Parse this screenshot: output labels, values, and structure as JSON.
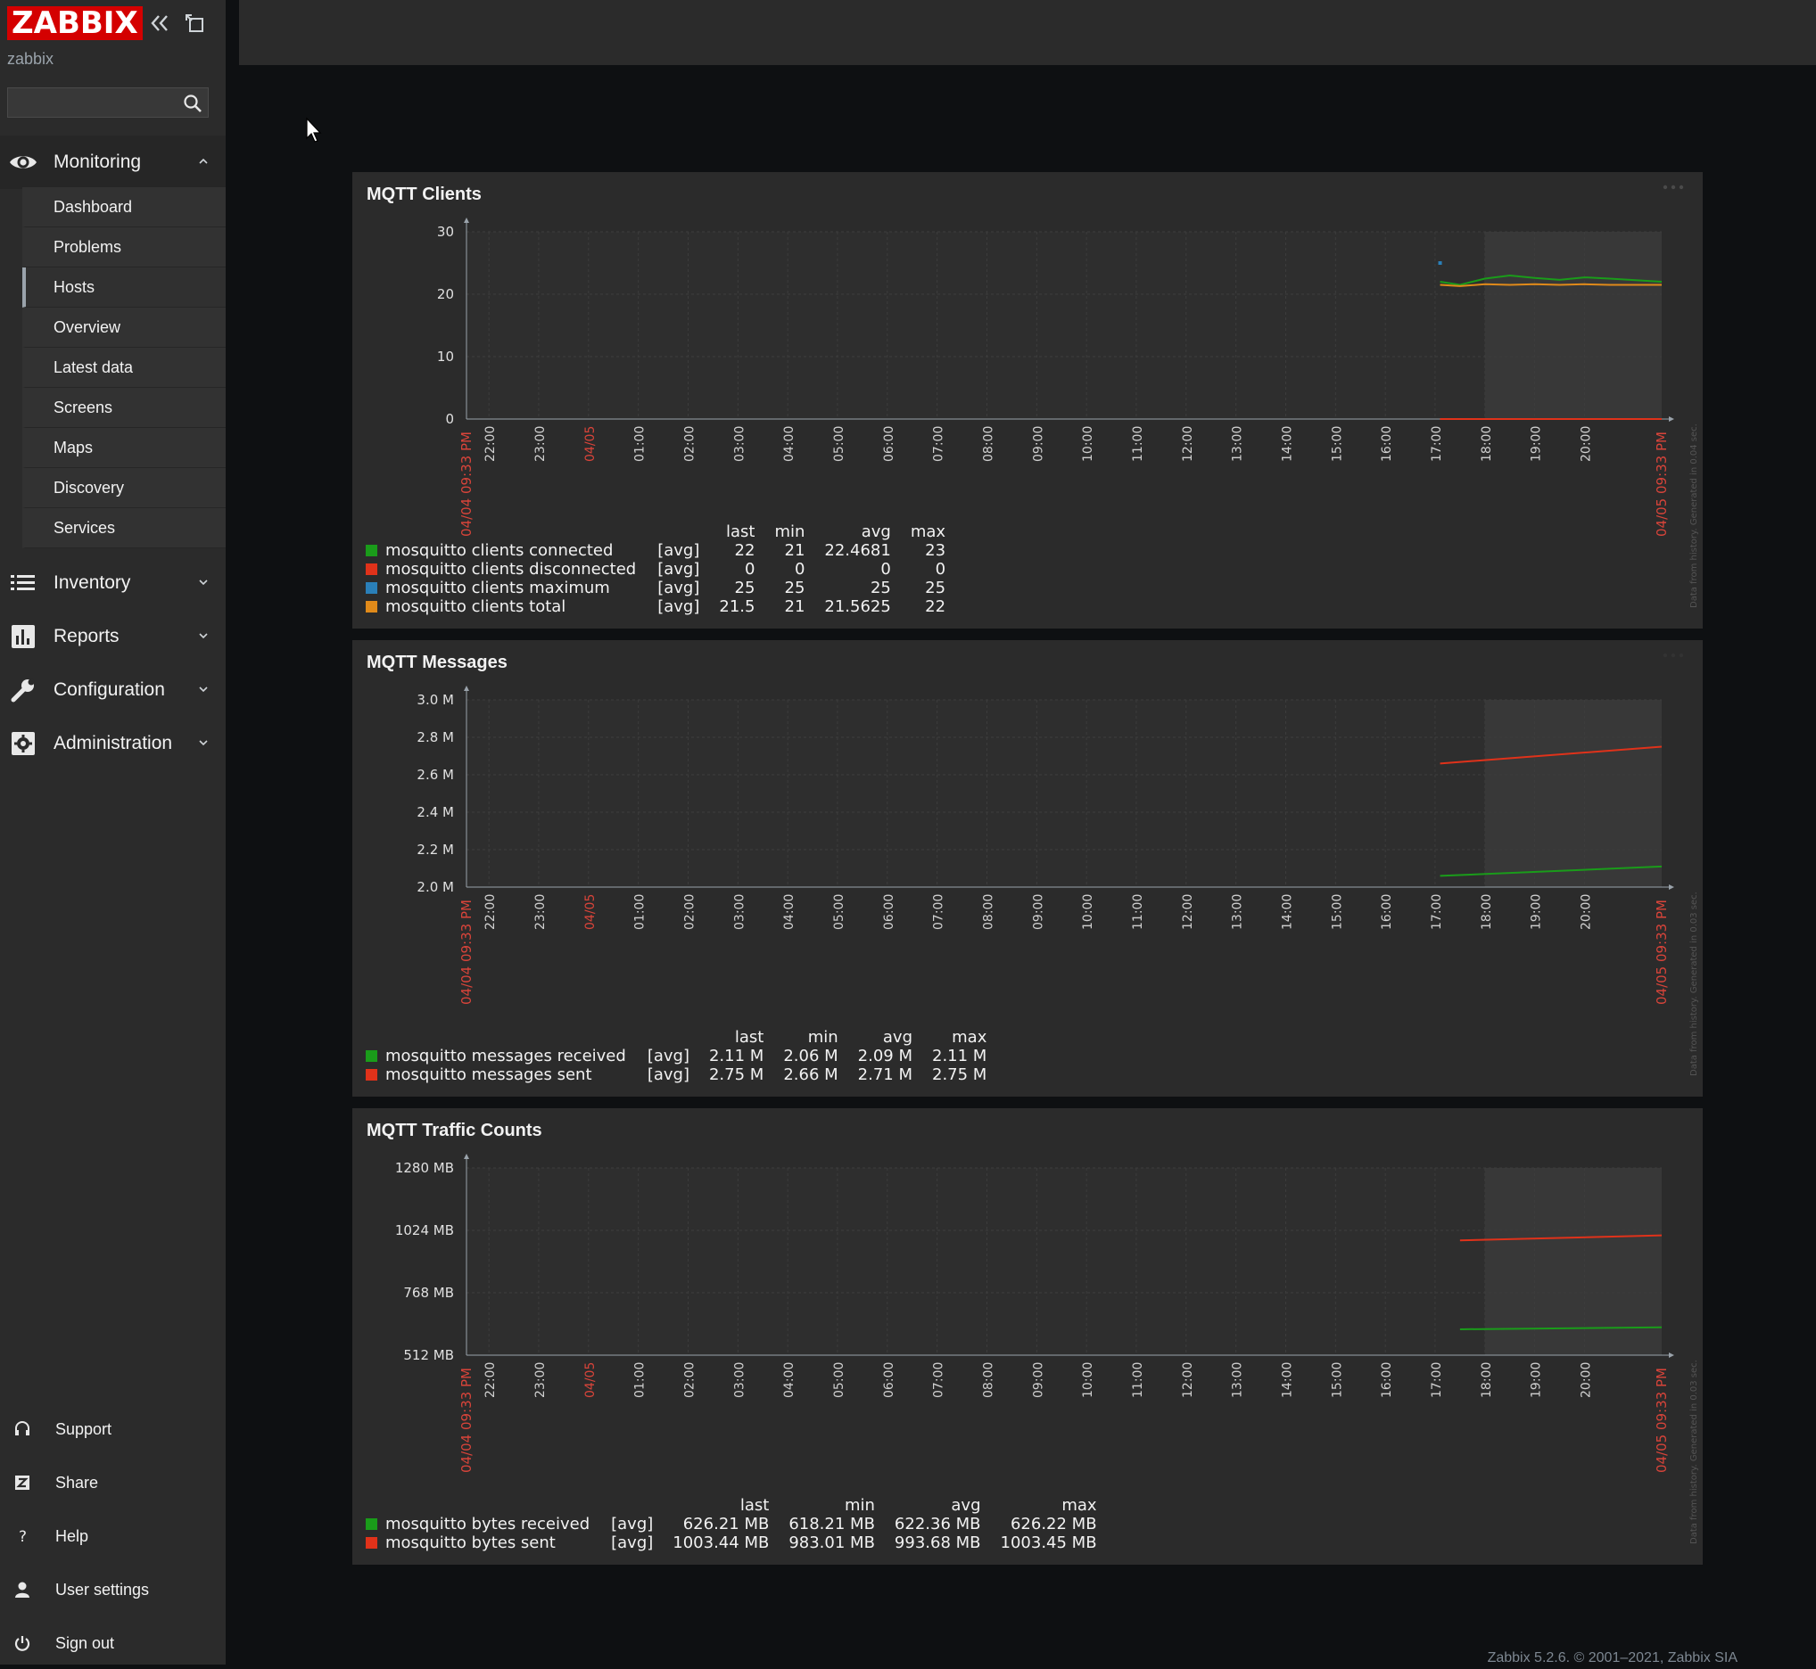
{
  "sidebar": {
    "logo": "ZABBIX",
    "server_name": "zabbix",
    "search_placeholder": "",
    "monitoring": {
      "label": "Monitoring",
      "items": [
        "Dashboard",
        "Problems",
        "Hosts",
        "Overview",
        "Latest data",
        "Screens",
        "Maps",
        "Discovery",
        "Services"
      ],
      "active": "Hosts"
    },
    "sections": [
      "Inventory",
      "Reports",
      "Configuration",
      "Administration"
    ],
    "bottom": [
      "Support",
      "Share",
      "Help",
      "User settings",
      "Sign out"
    ]
  },
  "time_axis": {
    "start_label": "04/04 09:33 PM",
    "end_label": "04/05 09:33 PM",
    "ticks": [
      "22:00",
      "23:00",
      "04/05",
      "01:00",
      "02:00",
      "03:00",
      "04:00",
      "05:00",
      "06:00",
      "07:00",
      "08:00",
      "09:00",
      "10:00",
      "11:00",
      "12:00",
      "13:00",
      "14:00",
      "15:00",
      "16:00",
      "17:00",
      "18:00",
      "19:00",
      "20:00"
    ],
    "side_note_clients": "Data from history. Generated in 0.04 sec.",
    "side_note_messages": "Data from history. Generated in 0.03 sec.",
    "side_note_traffic": "Data from history. Generated in 0.03 sec."
  },
  "legend_headers": [
    "last",
    "min",
    "avg",
    "max"
  ],
  "chart_data": [
    {
      "type": "line",
      "title": "MQTT Clients",
      "yticks": [
        "30",
        "20",
        "10",
        "0"
      ],
      "ylim": [
        0,
        30
      ],
      "x_hours": [
        17.1,
        17.5,
        18.0,
        18.5,
        19.0,
        19.5,
        20.0,
        20.5,
        21.55
      ],
      "series": [
        {
          "name": "mosquitto clients connected",
          "func": "[avg]",
          "color": "#1a9c1a",
          "values": [
            22,
            21.5,
            22.5,
            23,
            22.6,
            22.3,
            22.7,
            22.5,
            22
          ],
          "last": "22",
          "min": "21",
          "avg": "22.4681",
          "max": "23"
        },
        {
          "name": "mosquitto clients disconnected",
          "func": "[avg]",
          "color": "#e0321a",
          "values": [
            0,
            0,
            0,
            0,
            0,
            0,
            0,
            0,
            0
          ],
          "last": "0",
          "min": "0",
          "avg": "0",
          "max": "0"
        },
        {
          "name": "mosquitto clients maximum",
          "func": "[avg]",
          "color": "#2a7fb8",
          "values": [
            25,
            null,
            null,
            null,
            null,
            null,
            null,
            null,
            null
          ],
          "last": "25",
          "min": "25",
          "avg": "25",
          "max": "25"
        },
        {
          "name": "mosquitto clients total",
          "func": "[avg]",
          "color": "#e08a1a",
          "values": [
            21.5,
            21.3,
            21.6,
            21.5,
            21.6,
            21.5,
            21.6,
            21.5,
            21.5
          ],
          "last": "21.5",
          "min": "21",
          "avg": "21.5625",
          "max": "22"
        }
      ]
    },
    {
      "type": "line",
      "title": "MQTT Messages",
      "yticks": [
        "3.0 M",
        "2.8 M",
        "2.6 M",
        "2.4 M",
        "2.2 M",
        "2.0 M"
      ],
      "ylim": [
        2.0,
        3.0
      ],
      "x_hours": [
        17.1,
        21.55
      ],
      "series": [
        {
          "name": "mosquitto messages received",
          "func": "[avg]",
          "color": "#1a9c1a",
          "values": [
            2.06,
            2.11
          ],
          "last": "2.11 M",
          "min": "2.06 M",
          "avg": "2.09 M",
          "max": "2.11 M"
        },
        {
          "name": "mosquitto messages sent",
          "func": "[avg]",
          "color": "#e0321a",
          "values": [
            2.66,
            2.75
          ],
          "last": "2.75 M",
          "min": "2.66 M",
          "avg": "2.71 M",
          "max": "2.75 M"
        }
      ]
    },
    {
      "type": "line",
      "title": "MQTT Traffic Counts",
      "yticks": [
        "1280 MB",
        "1024 MB",
        "768 MB",
        "512 MB"
      ],
      "ylim": [
        512,
        1280
      ],
      "x_hours": [
        17.5,
        21.55
      ],
      "series": [
        {
          "name": "mosquitto bytes received",
          "func": "[avg]",
          "color": "#1a9c1a",
          "values": [
            618.21,
            626.22
          ],
          "last": "626.21 MB",
          "min": "618.21 MB",
          "avg": "622.36 MB",
          "max": "626.22 MB"
        },
        {
          "name": "mosquitto bytes sent",
          "func": "[avg]",
          "color": "#e0321a",
          "values": [
            983.01,
            1003.45
          ],
          "last": "1003.44 MB",
          "min": "983.01 MB",
          "avg": "993.68 MB",
          "max": "1003.45 MB"
        }
      ]
    }
  ],
  "footer": "Zabbix 5.2.6. © 2001–2021, Zabbix SIA"
}
